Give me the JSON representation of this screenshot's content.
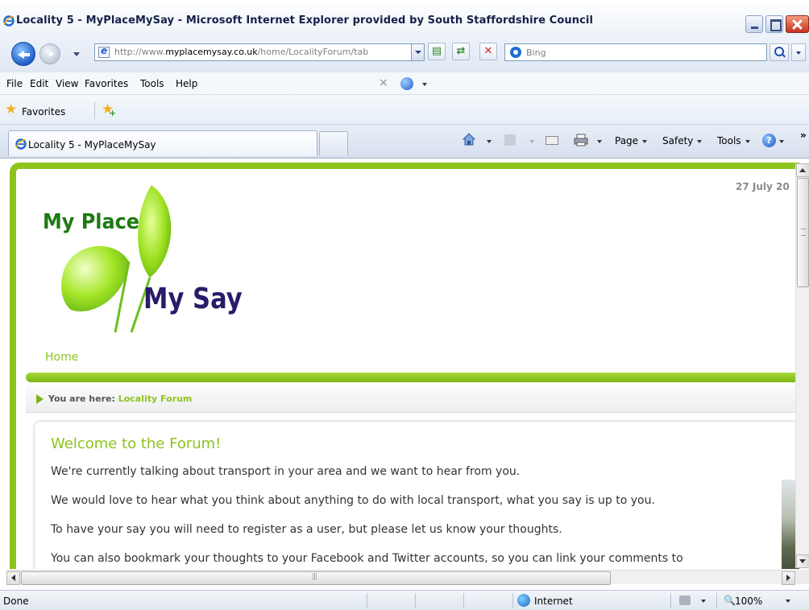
{
  "window": {
    "title": "Locality 5 - MyPlaceMySay - Microsoft Internet Explorer provided by South Staffordshire Council"
  },
  "address": {
    "url_prefix": "http://www.",
    "url_domain": "myplacemysay.co.uk",
    "url_path": "/home/LocalityForum/tab",
    "search_placeholder": "Bing"
  },
  "menu": {
    "items": [
      "File",
      "Edit",
      "View",
      "Favorites",
      "Tools",
      "Help"
    ]
  },
  "favorites_bar": {
    "label": "Favorites"
  },
  "tabs": {
    "active_label": "Locality 5 - MyPlaceMySay"
  },
  "command_bar": {
    "page": "Page",
    "safety": "Safety",
    "tools": "Tools",
    "help_glyph": "?",
    "more": "»"
  },
  "page": {
    "date": "27 July 20",
    "logo_top": "My Place",
    "logo_bottom": "My Say",
    "nav_home": "Home",
    "breadcrumb_label": "You are here: ",
    "breadcrumb_link": "Locality Forum",
    "heading": "Welcome to the Forum!",
    "paragraphs": [
      "We're currently talking about transport in your area and we want to hear from you.",
      "We would love to hear what you think about anything to do with local transport, what you say is up to you.",
      "To have your say you will need to register as a user, but please let us know your thoughts.",
      "You can also bookmark your thoughts to your Facebook and Twitter accounts, so you can link your comments to"
    ]
  },
  "status": {
    "text": "Done",
    "zone": "Internet",
    "zoom": "100%"
  },
  "colors": {
    "brand_green": "#8cc41c",
    "logo_green": "#1e7a12",
    "logo_purple": "#2a1a6a"
  },
  "icons": [
    "ie-logo-icon",
    "back-arrow-icon",
    "forward-arrow-icon",
    "page-icon",
    "compatibility-icon",
    "refresh-icon",
    "stop-icon",
    "bing-icon",
    "search-icon",
    "star-icon",
    "add-favorite-icon",
    "home-icon",
    "feed-icon",
    "mail-icon",
    "print-icon",
    "help-icon",
    "globe-icon",
    "zoom-icon"
  ]
}
